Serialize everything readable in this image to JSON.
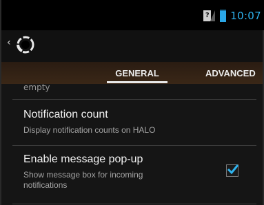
{
  "status_bar": {
    "sim_label": "?",
    "time": "10:07"
  },
  "tabs": [
    {
      "label": "GENERAL",
      "selected": true
    },
    {
      "label": "ADVANCED",
      "selected": false
    }
  ],
  "list": {
    "partial_item_text": "empty",
    "items": [
      {
        "title": "Notification count",
        "summary": "Display notification counts on HALO"
      },
      {
        "title": "Enable message pop-up",
        "summary_line1": "Show message box for incoming",
        "summary_line2": "notifications",
        "checked": true
      }
    ]
  },
  "colors": {
    "accent": "#2eb4f0",
    "tab_bar": "#3a2717"
  }
}
